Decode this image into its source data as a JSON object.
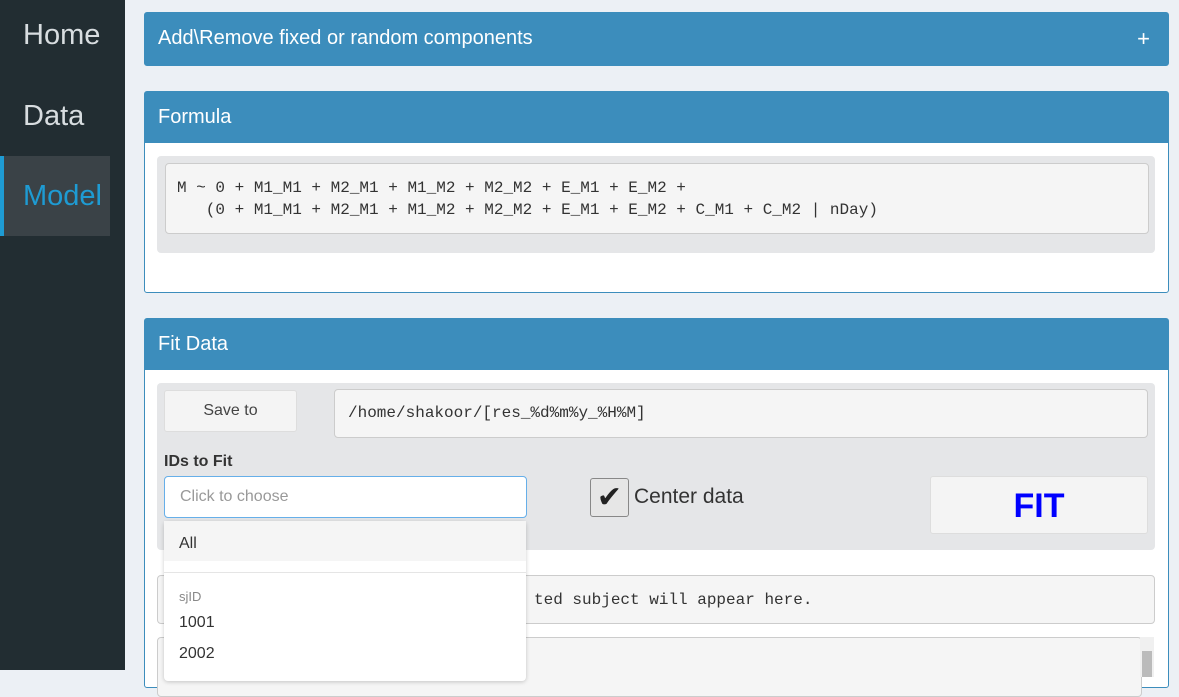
{
  "sidebar": {
    "items": [
      {
        "label": "Home"
      },
      {
        "label": "Data"
      },
      {
        "label": "Model"
      }
    ]
  },
  "components_box": {
    "title": "Add\\Remove fixed or random components",
    "toggle": "+"
  },
  "formula_box": {
    "title": "Formula",
    "line1": "M ~ 0 + M1_M1 + M2_M1 + M1_M2 + M2_M2 + E_M1 + E_M2 +",
    "line2": "   (0 + M1_M1 + M2_M1 + M1_M2 + M2_M2 + E_M1 + E_M2 + C_M1 + C_M2 | nDay)"
  },
  "fit_box": {
    "title": "Fit Data",
    "save_label": "Save to",
    "save_path": "/home/shakoor/[res_%d%m%y_%H%M]",
    "ids_label": "IDs to Fit",
    "ids_placeholder": "Click to choose",
    "center_label": "Center data",
    "center_checked": true,
    "fit_label": "FIT",
    "output_text": "ted subject will appear here.",
    "dropdown": {
      "all": "All",
      "group": "sjID",
      "options": [
        "1001",
        "2002"
      ]
    }
  },
  "colors": {
    "accent": "#3c8dbc",
    "fit": "#0000ff"
  }
}
